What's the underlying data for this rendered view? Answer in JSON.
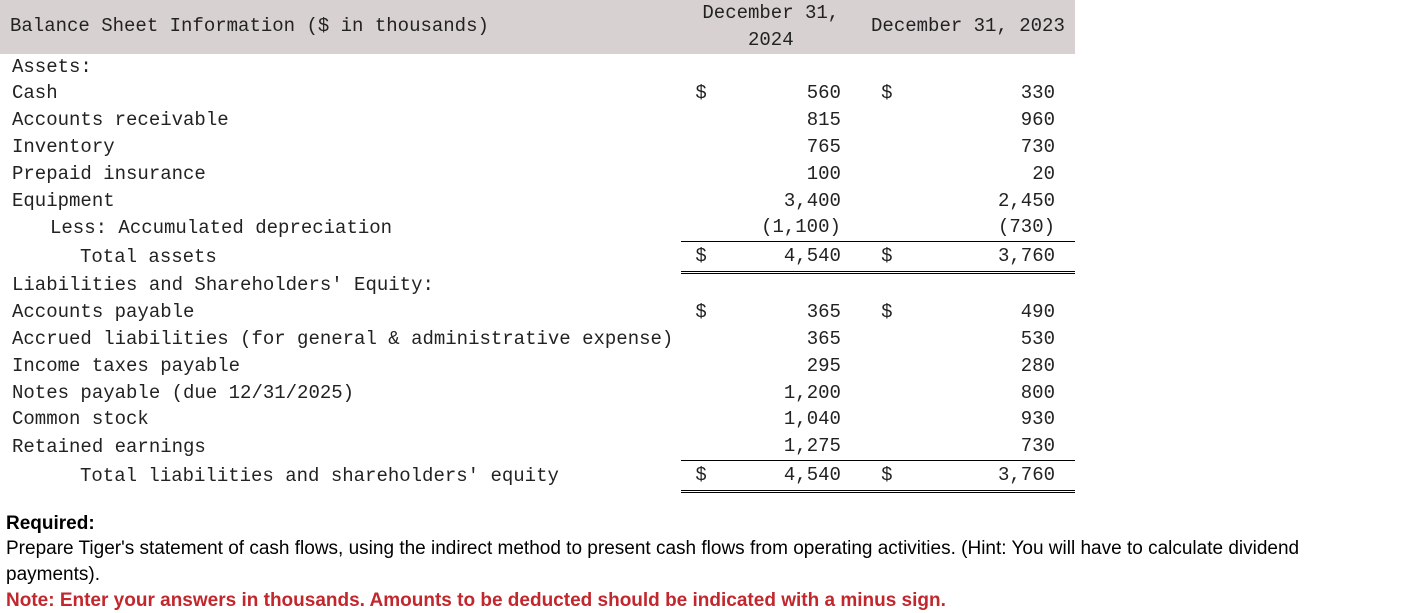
{
  "table": {
    "title": "Balance Sheet Information ($ in thousands)",
    "columns": {
      "col1_line1": "December 31,",
      "col1_line2": "2024",
      "col2": "December 31, 2023"
    },
    "sections": {
      "assets_heading": "Assets:",
      "liab_heading": "Liabilities and Shareholders' Equity:"
    },
    "rows": {
      "cash": {
        "label": "Cash",
        "c1_sym": "$",
        "c1": "560",
        "c2_sym": "$",
        "c2": "330"
      },
      "ar": {
        "label": "Accounts receivable",
        "c1_sym": "",
        "c1": "815",
        "c2_sym": "",
        "c2": "960"
      },
      "inventory": {
        "label": "Inventory",
        "c1_sym": "",
        "c1": "765",
        "c2_sym": "",
        "c2": "730"
      },
      "prepaid": {
        "label": "Prepaid insurance",
        "c1_sym": "",
        "c1": "100",
        "c2_sym": "",
        "c2": "20"
      },
      "equipment": {
        "label": "Equipment",
        "c1_sym": "",
        "c1": "3,400",
        "c2_sym": "",
        "c2": "2,450"
      },
      "acc_dep": {
        "label": "Less: Accumulated depreciation",
        "c1_sym": "",
        "c1": "(1,100)",
        "c2_sym": "",
        "c2": "(730)"
      },
      "total_assets": {
        "label": "Total assets",
        "c1_sym": "$",
        "c1": "4,540",
        "c2_sym": "$",
        "c2": "3,760"
      },
      "ap": {
        "label": "Accounts payable",
        "c1_sym": "$",
        "c1": "365",
        "c2_sym": "$",
        "c2": "490"
      },
      "accrued": {
        "label": "Accrued liabilities (for general & administrative expense)",
        "c1_sym": "",
        "c1": "365",
        "c2_sym": "",
        "c2": "530"
      },
      "taxes": {
        "label": "Income taxes payable",
        "c1_sym": "",
        "c1": "295",
        "c2_sym": "",
        "c2": "280"
      },
      "notes": {
        "label": "Notes payable (due 12/31/2025)",
        "c1_sym": "",
        "c1": "1,200",
        "c2_sym": "",
        "c2": "800"
      },
      "common": {
        "label": "Common stock",
        "c1_sym": "",
        "c1": "1,040",
        "c2_sym": "",
        "c2": "930"
      },
      "retained": {
        "label": "Retained earnings",
        "c1_sym": "",
        "c1": "1,275",
        "c2_sym": "",
        "c2": "730"
      },
      "total_liab": {
        "label": "Total liabilities and shareholders' equity",
        "c1_sym": "$",
        "c1": "4,540",
        "c2_sym": "$",
        "c2": "3,760"
      }
    }
  },
  "required": {
    "heading": "Required:",
    "body": "Prepare Tiger's statement of cash flows, using the indirect method to present cash flows from operating activities. (Hint: You will have to calculate dividend payments).",
    "note": "Note: Enter your answers in thousands. Amounts to be deducted should be indicated with a minus sign."
  }
}
